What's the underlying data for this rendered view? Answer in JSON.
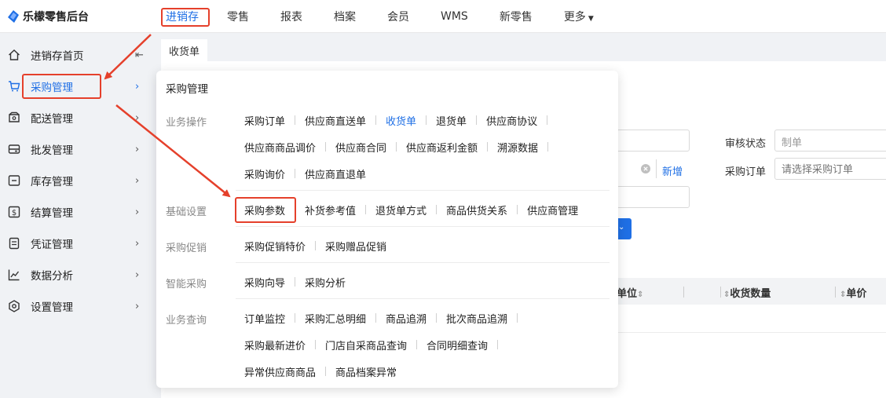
{
  "app": {
    "title": "乐檬零售后台"
  },
  "topnav": [
    {
      "label": "进销存"
    },
    {
      "label": "零售"
    },
    {
      "label": "报表"
    },
    {
      "label": "档案"
    },
    {
      "label": "会员"
    },
    {
      "label": "WMS"
    },
    {
      "label": "新零售"
    },
    {
      "label": "更多"
    }
  ],
  "sidebar": {
    "items": [
      {
        "label": "进销存首页",
        "icon": "home-icon"
      },
      {
        "label": "采购管理",
        "icon": "cart-icon"
      },
      {
        "label": "配送管理",
        "icon": "delivery-icon"
      },
      {
        "label": "批发管理",
        "icon": "wholesale-icon"
      },
      {
        "label": "库存管理",
        "icon": "inventory-icon"
      },
      {
        "label": "结算管理",
        "icon": "settlement-icon"
      },
      {
        "label": "凭证管理",
        "icon": "voucher-icon"
      },
      {
        "label": "数据分析",
        "icon": "chart-icon"
      },
      {
        "label": "设置管理",
        "icon": "settings-icon"
      }
    ]
  },
  "tab": {
    "label": "收货单"
  },
  "form": {
    "audit_status_label": "审核状态",
    "audit_status_value": "制单",
    "purchase_order_label": "采购订单",
    "purchase_order_placeholder": "请选择采购订单",
    "add_label": "新增"
  },
  "table": {
    "headers": [
      "单位",
      "收货数量",
      "单价"
    ]
  },
  "dropdown": {
    "title": "采购管理",
    "sections": [
      {
        "category": "业务操作",
        "rows": [
          [
            "采购订单",
            "供应商直送单",
            "收货单",
            "退货单",
            "供应商协议"
          ],
          [
            "供应商商品调价",
            "供应商合同",
            "供应商返利金额",
            "溯源数据"
          ],
          [
            "采购询价",
            "供应商直退单"
          ]
        ]
      },
      {
        "category": "基础设置",
        "rows": [
          [
            "采购参数",
            "补货参考值",
            "退货单方式",
            "商品供货关系",
            "供应商管理"
          ]
        ]
      },
      {
        "category": "采购促销",
        "rows": [
          [
            "采购促销特价",
            "采购赠品促销"
          ]
        ]
      },
      {
        "category": "智能采购",
        "rows": [
          [
            "采购向导",
            "采购分析"
          ]
        ]
      },
      {
        "category": "业务查询",
        "rows": [
          [
            "订单监控",
            "采购汇总明细",
            "商品追溯",
            "批次商品追溯"
          ],
          [
            "采购最新进价",
            "门店自采商品查询",
            "合同明细查询"
          ],
          [
            "异常供应商商品",
            "商品档案异常"
          ]
        ]
      }
    ]
  },
  "colors": {
    "accent": "#1f6fe5",
    "highlight": "#e5402b"
  }
}
